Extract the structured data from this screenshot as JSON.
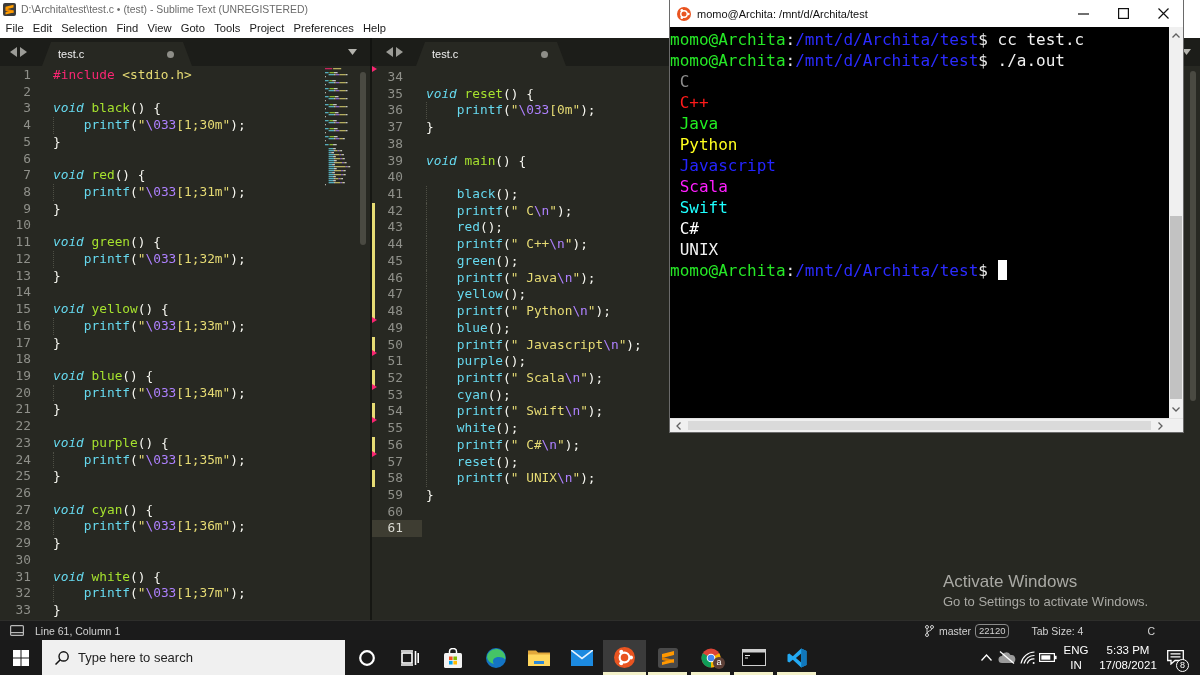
{
  "window": {
    "title": "D:\\Archita\\test\\test.c • (test) - Sublime Text (UNREGISTERED)"
  },
  "menu": [
    "File",
    "Edit",
    "Selection",
    "Find",
    "View",
    "Goto",
    "Tools",
    "Project",
    "Preferences",
    "Help"
  ],
  "panes": [
    {
      "tabs": [
        {
          "label": "test.c",
          "selected": true,
          "dirty": true
        }
      ],
      "minimap": true,
      "lines": [
        {
          "number": "1",
          "tokens": [
            {
              "kind": "preprocessor",
              "text": "#include"
            },
            {
              "kind": "string",
              "text": " <stdio.h>"
            }
          ]
        },
        {
          "number": "2"
        },
        {
          "number": "3",
          "tokens": [
            {
              "kind": "storage",
              "text": "void"
            },
            {
              "kind": "entity",
              "text": " black"
            },
            {
              "kind": "plain",
              "text": "() {"
            }
          ]
        },
        {
          "number": "4",
          "tokens": [
            {
              "kind": "support",
              "text": "    printf"
            },
            {
              "kind": "plain",
              "text": "("
            },
            {
              "kind": "string",
              "text": "\""
            },
            {
              "kind": "escape",
              "text": "\\033"
            },
            {
              "kind": "string",
              "text": "[1;30m\""
            },
            {
              "kind": "plain",
              "text": ");"
            }
          ]
        },
        {
          "number": "5",
          "tokens": [
            {
              "kind": "plain",
              "text": "}"
            }
          ]
        },
        {
          "number": "6"
        },
        {
          "number": "7",
          "tokens": [
            {
              "kind": "storage",
              "text": "void"
            },
            {
              "kind": "entity",
              "text": " red"
            },
            {
              "kind": "plain",
              "text": "() {"
            }
          ]
        },
        {
          "number": "8",
          "tokens": [
            {
              "kind": "support",
              "text": "    printf"
            },
            {
              "kind": "plain",
              "text": "("
            },
            {
              "kind": "string",
              "text": "\""
            },
            {
              "kind": "escape",
              "text": "\\033"
            },
            {
              "kind": "string",
              "text": "[1;31m\""
            },
            {
              "kind": "plain",
              "text": ");"
            }
          ]
        },
        {
          "number": "9",
          "tokens": [
            {
              "kind": "plain",
              "text": "}"
            }
          ]
        },
        {
          "number": "10"
        },
        {
          "number": "11",
          "tokens": [
            {
              "kind": "storage",
              "text": "void"
            },
            {
              "kind": "entity",
              "text": " green"
            },
            {
              "kind": "plain",
              "text": "() {"
            }
          ]
        },
        {
          "number": "12",
          "tokens": [
            {
              "kind": "support",
              "text": "    printf"
            },
            {
              "kind": "plain",
              "text": "("
            },
            {
              "kind": "string",
              "text": "\""
            },
            {
              "kind": "escape",
              "text": "\\033"
            },
            {
              "kind": "string",
              "text": "[1;32m\""
            },
            {
              "kind": "plain",
              "text": ");"
            }
          ]
        },
        {
          "number": "13",
          "tokens": [
            {
              "kind": "plain",
              "text": "}"
            }
          ]
        },
        {
          "number": "14"
        },
        {
          "number": "15",
          "tokens": [
            {
              "kind": "storage",
              "text": "void"
            },
            {
              "kind": "entity",
              "text": " yellow"
            },
            {
              "kind": "plain",
              "text": "() {"
            }
          ]
        },
        {
          "number": "16",
          "tokens": [
            {
              "kind": "support",
              "text": "    printf"
            },
            {
              "kind": "plain",
              "text": "("
            },
            {
              "kind": "string",
              "text": "\""
            },
            {
              "kind": "escape",
              "text": "\\033"
            },
            {
              "kind": "string",
              "text": "[1;33m\""
            },
            {
              "kind": "plain",
              "text": ");"
            }
          ]
        },
        {
          "number": "17",
          "tokens": [
            {
              "kind": "plain",
              "text": "}"
            }
          ]
        },
        {
          "number": "18"
        },
        {
          "number": "19",
          "tokens": [
            {
              "kind": "storage",
              "text": "void"
            },
            {
              "kind": "entity",
              "text": " blue"
            },
            {
              "kind": "plain",
              "text": "() {"
            }
          ]
        },
        {
          "number": "20",
          "tokens": [
            {
              "kind": "support",
              "text": "    printf"
            },
            {
              "kind": "plain",
              "text": "("
            },
            {
              "kind": "string",
              "text": "\""
            },
            {
              "kind": "escape",
              "text": "\\033"
            },
            {
              "kind": "string",
              "text": "[1;34m\""
            },
            {
              "kind": "plain",
              "text": ");"
            }
          ]
        },
        {
          "number": "21",
          "tokens": [
            {
              "kind": "plain",
              "text": "}"
            }
          ]
        },
        {
          "number": "22"
        },
        {
          "number": "23",
          "tokens": [
            {
              "kind": "storage",
              "text": "void"
            },
            {
              "kind": "entity",
              "text": " purple"
            },
            {
              "kind": "plain",
              "text": "() {"
            }
          ]
        },
        {
          "number": "24",
          "tokens": [
            {
              "kind": "support",
              "text": "    printf"
            },
            {
              "kind": "plain",
              "text": "("
            },
            {
              "kind": "string",
              "text": "\""
            },
            {
              "kind": "escape",
              "text": "\\033"
            },
            {
              "kind": "string",
              "text": "[1;35m\""
            },
            {
              "kind": "plain",
              "text": ");"
            }
          ]
        },
        {
          "number": "25",
          "tokens": [
            {
              "kind": "plain",
              "text": "}"
            }
          ]
        },
        {
          "number": "26"
        },
        {
          "number": "27",
          "tokens": [
            {
              "kind": "storage",
              "text": "void"
            },
            {
              "kind": "entity",
              "text": " cyan"
            },
            {
              "kind": "plain",
              "text": "() {"
            }
          ]
        },
        {
          "number": "28",
          "tokens": [
            {
              "kind": "support",
              "text": "    printf"
            },
            {
              "kind": "plain",
              "text": "("
            },
            {
              "kind": "string",
              "text": "\""
            },
            {
              "kind": "escape",
              "text": "\\033"
            },
            {
              "kind": "string",
              "text": "[1;36m\""
            },
            {
              "kind": "plain",
              "text": ");"
            }
          ]
        },
        {
          "number": "29",
          "tokens": [
            {
              "kind": "plain",
              "text": "}"
            }
          ]
        },
        {
          "number": "30"
        },
        {
          "number": "31",
          "tokens": [
            {
              "kind": "storage",
              "text": "void"
            },
            {
              "kind": "entity",
              "text": " white"
            },
            {
              "kind": "plain",
              "text": "() {"
            }
          ]
        },
        {
          "number": "32",
          "tokens": [
            {
              "kind": "support",
              "text": "    printf"
            },
            {
              "kind": "plain",
              "text": "("
            },
            {
              "kind": "string",
              "text": "\""
            },
            {
              "kind": "escape",
              "text": "\\033"
            },
            {
              "kind": "string",
              "text": "[1;37m\""
            },
            {
              "kind": "plain",
              "text": ");"
            }
          ]
        },
        {
          "number": "33",
          "tokens": [
            {
              "kind": "plain",
              "text": "}"
            }
          ]
        }
      ]
    },
    {
      "tabs": [
        {
          "label": "test.c",
          "selected": true,
          "dirty": true
        }
      ],
      "deleted_above": true,
      "lines": [
        {
          "number": "34",
          "modified": false,
          "deleted_below": false,
          "current": false
        },
        {
          "number": "35",
          "modified": false,
          "deleted_below": false,
          "current": false,
          "tokens": [
            {
              "kind": "storage",
              "text": "void"
            },
            {
              "kind": "entity",
              "text": " reset"
            },
            {
              "kind": "plain",
              "text": "() {"
            }
          ]
        },
        {
          "number": "36",
          "modified": false,
          "deleted_below": false,
          "current": false,
          "tokens": [
            {
              "kind": "support",
              "text": "    printf"
            },
            {
              "kind": "plain",
              "text": "("
            },
            {
              "kind": "string",
              "text": "\""
            },
            {
              "kind": "escape",
              "text": "\\033"
            },
            {
              "kind": "string",
              "text": "[0m\""
            },
            {
              "kind": "plain",
              "text": ");"
            }
          ]
        },
        {
          "number": "37",
          "modified": false,
          "deleted_below": false,
          "current": false,
          "tokens": [
            {
              "kind": "plain",
              "text": "}"
            }
          ]
        },
        {
          "number": "38",
          "modified": false,
          "deleted_below": false,
          "current": false
        },
        {
          "number": "39",
          "modified": false,
          "deleted_below": false,
          "current": false,
          "tokens": [
            {
              "kind": "storage",
              "text": "void"
            },
            {
              "kind": "entity",
              "text": " main"
            },
            {
              "kind": "plain",
              "text": "() {"
            }
          ]
        },
        {
          "number": "40",
          "modified": false,
          "deleted_below": false,
          "current": false
        },
        {
          "number": "41",
          "modified": false,
          "deleted_below": false,
          "current": false,
          "tokens": [
            {
              "kind": "call",
              "text": "    black"
            },
            {
              "kind": "plain",
              "text": "();"
            }
          ]
        },
        {
          "number": "42",
          "modified": true,
          "deleted_below": false,
          "current": false,
          "tokens": [
            {
              "kind": "support",
              "text": "    printf"
            },
            {
              "kind": "plain",
              "text": "("
            },
            {
              "kind": "string",
              "text": "\" C"
            },
            {
              "kind": "escape",
              "text": "\\n"
            },
            {
              "kind": "string",
              "text": "\""
            },
            {
              "kind": "plain",
              "text": ");"
            }
          ]
        },
        {
          "number": "43",
          "modified": true,
          "deleted_below": false,
          "current": false,
          "tokens": [
            {
              "kind": "call",
              "text": "    red"
            },
            {
              "kind": "plain",
              "text": "();"
            }
          ]
        },
        {
          "number": "44",
          "modified": true,
          "deleted_below": false,
          "current": false,
          "tokens": [
            {
              "kind": "support",
              "text": "    printf"
            },
            {
              "kind": "plain",
              "text": "("
            },
            {
              "kind": "string",
              "text": "\" C++"
            },
            {
              "kind": "escape",
              "text": "\\n"
            },
            {
              "kind": "string",
              "text": "\""
            },
            {
              "kind": "plain",
              "text": ");"
            }
          ]
        },
        {
          "number": "45",
          "modified": true,
          "deleted_below": false,
          "current": false,
          "tokens": [
            {
              "kind": "call",
              "text": "    green"
            },
            {
              "kind": "plain",
              "text": "();"
            }
          ]
        },
        {
          "number": "46",
          "modified": true,
          "deleted_below": false,
          "current": false,
          "tokens": [
            {
              "kind": "support",
              "text": "    printf"
            },
            {
              "kind": "plain",
              "text": "("
            },
            {
              "kind": "string",
              "text": "\" Java"
            },
            {
              "kind": "escape",
              "text": "\\n"
            },
            {
              "kind": "string",
              "text": "\""
            },
            {
              "kind": "plain",
              "text": ");"
            }
          ]
        },
        {
          "number": "47",
          "modified": true,
          "deleted_below": false,
          "current": false,
          "tokens": [
            {
              "kind": "call",
              "text": "    yellow"
            },
            {
              "kind": "plain",
              "text": "();"
            }
          ]
        },
        {
          "number": "48",
          "modified": true,
          "deleted_below": true,
          "current": false,
          "tokens": [
            {
              "kind": "support",
              "text": "    printf"
            },
            {
              "kind": "plain",
              "text": "("
            },
            {
              "kind": "string",
              "text": "\" Python"
            },
            {
              "kind": "escape",
              "text": "\\n"
            },
            {
              "kind": "string",
              "text": "\""
            },
            {
              "kind": "plain",
              "text": ");"
            }
          ]
        },
        {
          "number": "49",
          "modified": false,
          "deleted_below": false,
          "current": false,
          "tokens": [
            {
              "kind": "call",
              "text": "    blue"
            },
            {
              "kind": "plain",
              "text": "();"
            }
          ]
        },
        {
          "number": "50",
          "modified": true,
          "deleted_below": true,
          "current": false,
          "tokens": [
            {
              "kind": "support",
              "text": "    printf"
            },
            {
              "kind": "plain",
              "text": "("
            },
            {
              "kind": "string",
              "text": "\" Javascript"
            },
            {
              "kind": "escape",
              "text": "\\n"
            },
            {
              "kind": "string",
              "text": "\""
            },
            {
              "kind": "plain",
              "text": ");"
            }
          ]
        },
        {
          "number": "51",
          "modified": false,
          "deleted_below": false,
          "current": false,
          "tokens": [
            {
              "kind": "call",
              "text": "    purple"
            },
            {
              "kind": "plain",
              "text": "();"
            }
          ]
        },
        {
          "number": "52",
          "modified": true,
          "deleted_below": true,
          "current": false,
          "tokens": [
            {
              "kind": "support",
              "text": "    printf"
            },
            {
              "kind": "plain",
              "text": "("
            },
            {
              "kind": "string",
              "text": "\" Scala"
            },
            {
              "kind": "escape",
              "text": "\\n"
            },
            {
              "kind": "string",
              "text": "\""
            },
            {
              "kind": "plain",
              "text": ");"
            }
          ]
        },
        {
          "number": "53",
          "modified": false,
          "deleted_below": false,
          "current": false,
          "tokens": [
            {
              "kind": "call",
              "text": "    cyan"
            },
            {
              "kind": "plain",
              "text": "();"
            }
          ]
        },
        {
          "number": "54",
          "modified": true,
          "deleted_below": true,
          "current": false,
          "tokens": [
            {
              "kind": "support",
              "text": "    printf"
            },
            {
              "kind": "plain",
              "text": "("
            },
            {
              "kind": "string",
              "text": "\" Swift"
            },
            {
              "kind": "escape",
              "text": "\\n"
            },
            {
              "kind": "string",
              "text": "\""
            },
            {
              "kind": "plain",
              "text": ");"
            }
          ]
        },
        {
          "number": "55",
          "modified": false,
          "deleted_below": false,
          "current": false,
          "tokens": [
            {
              "kind": "call",
              "text": "    white"
            },
            {
              "kind": "plain",
              "text": "();"
            }
          ]
        },
        {
          "number": "56",
          "modified": true,
          "deleted_below": true,
          "current": false,
          "tokens": [
            {
              "kind": "support",
              "text": "    printf"
            },
            {
              "kind": "plain",
              "text": "("
            },
            {
              "kind": "string",
              "text": "\" C#"
            },
            {
              "kind": "escape",
              "text": "\\n"
            },
            {
              "kind": "string",
              "text": "\""
            },
            {
              "kind": "plain",
              "text": ");"
            }
          ]
        },
        {
          "number": "57",
          "modified": false,
          "deleted_below": false,
          "current": false,
          "tokens": [
            {
              "kind": "call",
              "text": "    reset"
            },
            {
              "kind": "plain",
              "text": "();"
            }
          ]
        },
        {
          "number": "58",
          "modified": true,
          "deleted_below": false,
          "current": false,
          "tokens": [
            {
              "kind": "support",
              "text": "    printf"
            },
            {
              "kind": "plain",
              "text": "("
            },
            {
              "kind": "string",
              "text": "\" UNIX"
            },
            {
              "kind": "escape",
              "text": "\\n"
            },
            {
              "kind": "string",
              "text": "\""
            },
            {
              "kind": "plain",
              "text": ");"
            }
          ]
        },
        {
          "number": "59",
          "modified": false,
          "deleted_below": false,
          "current": false,
          "tokens": [
            {
              "kind": "plain",
              "text": "}"
            }
          ]
        },
        {
          "number": "60",
          "modified": false,
          "deleted_below": false,
          "current": false
        },
        {
          "number": "61",
          "modified": false,
          "deleted_below": false,
          "current": true
        }
      ]
    }
  ],
  "status_bar": {
    "position": "Line 61, Column 1",
    "branch": "master",
    "changes": "22120",
    "tab_size": "Tab Size: 4",
    "syntax": "C"
  },
  "terminal": {
    "title": "momo@Archita: /mnt/d/Archita/test",
    "lines": [
      {
        "kind": "prompt",
        "user": "momo@Archita",
        "separator": ":",
        "path": "/mnt/d/Archita/test",
        "symbol": "$",
        "command": "cc test.c",
        "cursor": false
      },
      {
        "kind": "prompt",
        "user": "momo@Archita",
        "separator": ":",
        "path": "/mnt/d/Archita/test",
        "symbol": "$",
        "command": "./a.out",
        "cursor": false
      },
      {
        "kind": "output",
        "text": "C",
        "color": "#8c8c8c"
      },
      {
        "kind": "output",
        "text": "C++",
        "color": "#ff1a1a"
      },
      {
        "kind": "output",
        "text": "Java",
        "color": "#22f022"
      },
      {
        "kind": "output",
        "text": "Python",
        "color": "#ffff1e"
      },
      {
        "kind": "output",
        "text": "Javascript",
        "color": "#2424ff"
      },
      {
        "kind": "output",
        "text": "Scala",
        "color": "#ff1eff"
      },
      {
        "kind": "output",
        "text": "Swift",
        "color": "#1effff"
      },
      {
        "kind": "output",
        "text": "C#",
        "color": "#ffffff"
      },
      {
        "kind": "output",
        "text": "UNIX",
        "color": "#f2f2f2"
      },
      {
        "kind": "prompt",
        "user": "momo@Archita",
        "separator": ":",
        "path": "/mnt/d/Archita/test",
        "symbol": "$",
        "cursor": true
      }
    ]
  },
  "activation_notice": {
    "title": "Activate Windows",
    "text": "Go to Settings to activate Windows."
  },
  "taskbar": {
    "search": {
      "placeholder": "Type here to search"
    },
    "apps": [
      {
        "kind": "cortana",
        "running": false,
        "selected": false
      },
      {
        "kind": "task_view",
        "running": false,
        "selected": false
      },
      {
        "kind": "store",
        "running": false,
        "selected": false
      },
      {
        "kind": "edge",
        "running": false,
        "selected": false
      },
      {
        "kind": "file_explorer",
        "running": false,
        "selected": false
      },
      {
        "kind": "mail",
        "running": false,
        "selected": false
      },
      {
        "kind": "ubuntu",
        "running": true,
        "selected": true
      },
      {
        "kind": "sublime_text",
        "running": true,
        "selected": false
      },
      {
        "kind": "chrome",
        "running": true,
        "selected": false,
        "badge": "a"
      },
      {
        "kind": "command_prompt",
        "running": true,
        "selected": false
      },
      {
        "kind": "vs_code",
        "running": true,
        "selected": false
      }
    ],
    "language": "ENG",
    "region": "IN",
    "time": "5:33 PM",
    "date": "17/08/2021",
    "notifications": "8"
  }
}
